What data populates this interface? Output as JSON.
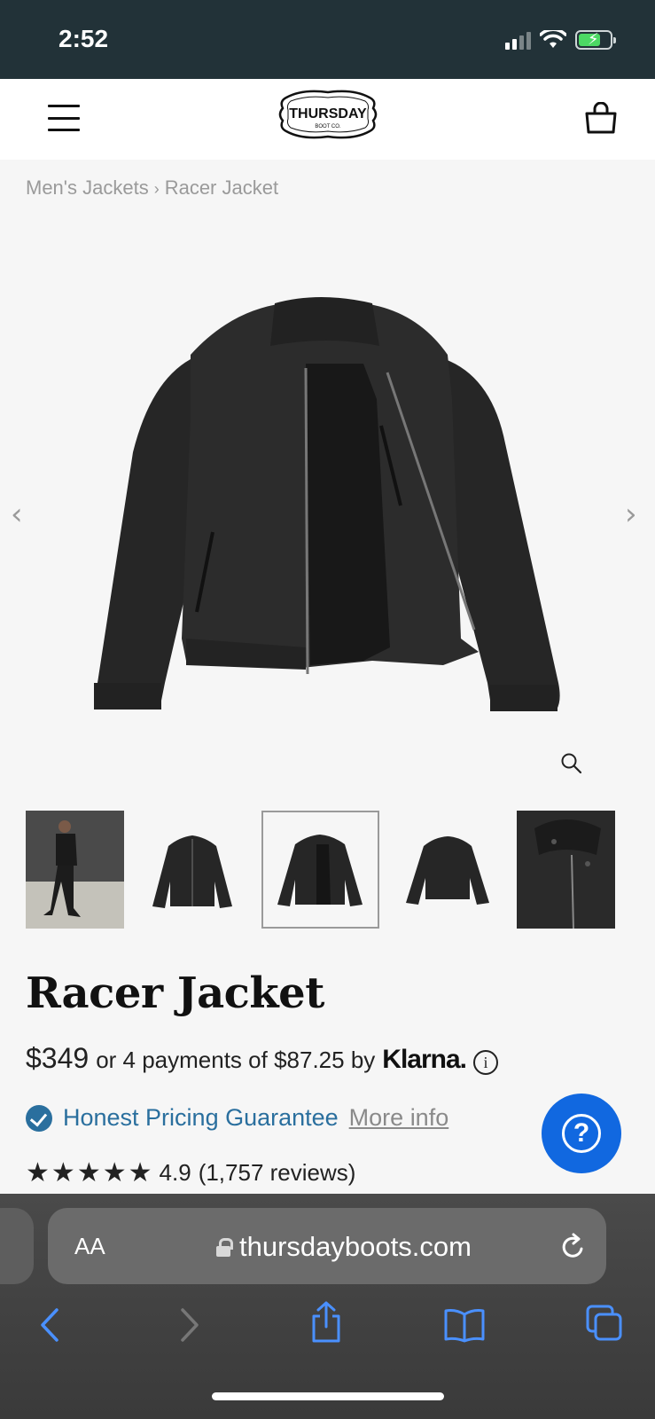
{
  "status_bar": {
    "time": "2:52"
  },
  "header": {
    "logo_text": "THURSDAY",
    "logo_subtext": "BOOT CO."
  },
  "breadcrumb": {
    "items": [
      "Men's Jackets",
      "Racer Jacket"
    ],
    "separator": "›"
  },
  "gallery": {
    "prev_arrow": "‹",
    "next_arrow": "›",
    "thumbnails": [
      {
        "name": "model-walking",
        "active": false
      },
      {
        "name": "front-closed",
        "active": false
      },
      {
        "name": "front-open",
        "active": true
      },
      {
        "name": "back",
        "active": false
      },
      {
        "name": "collar-detail",
        "active": false
      }
    ]
  },
  "product": {
    "title": "Racer Jacket",
    "price": "$349",
    "installments_text": "or 4 payments of $87.25 by",
    "klarna_brand": "Klarna.",
    "guarantee_label": "Honest Pricing Guarantee",
    "guarantee_link": "More info",
    "rating_value": "4.9",
    "review_count": "(1,757 reviews)",
    "stars": 5
  },
  "safari": {
    "text_size_label": "AA",
    "url": "thursdayboots.com"
  },
  "colors": {
    "status_bar_bg": "#223238",
    "link_blue": "#2a6f9e",
    "help_button": "#1168e0",
    "safari_accent": "#4a90ff"
  }
}
